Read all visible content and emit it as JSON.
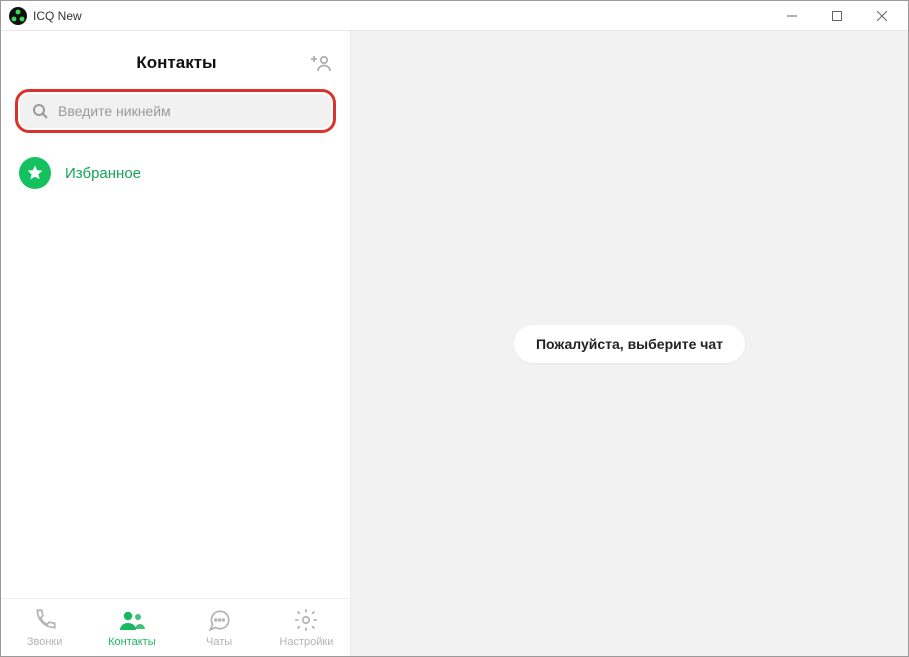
{
  "window": {
    "title": "ICQ New"
  },
  "sidebar": {
    "title": "Контакты",
    "search_placeholder": "Введите никнейм",
    "contacts": [
      {
        "label": "Избранное"
      }
    ]
  },
  "nav": {
    "items": [
      {
        "label": "Звонки"
      },
      {
        "label": "Контакты"
      },
      {
        "label": "Чаты"
      },
      {
        "label": "Настройки"
      }
    ],
    "active_index": 1
  },
  "main": {
    "placeholder": "Пожалуйста, выберите чат"
  },
  "colors": {
    "accent": "#13c25f",
    "highlight_border": "#d9342b"
  }
}
